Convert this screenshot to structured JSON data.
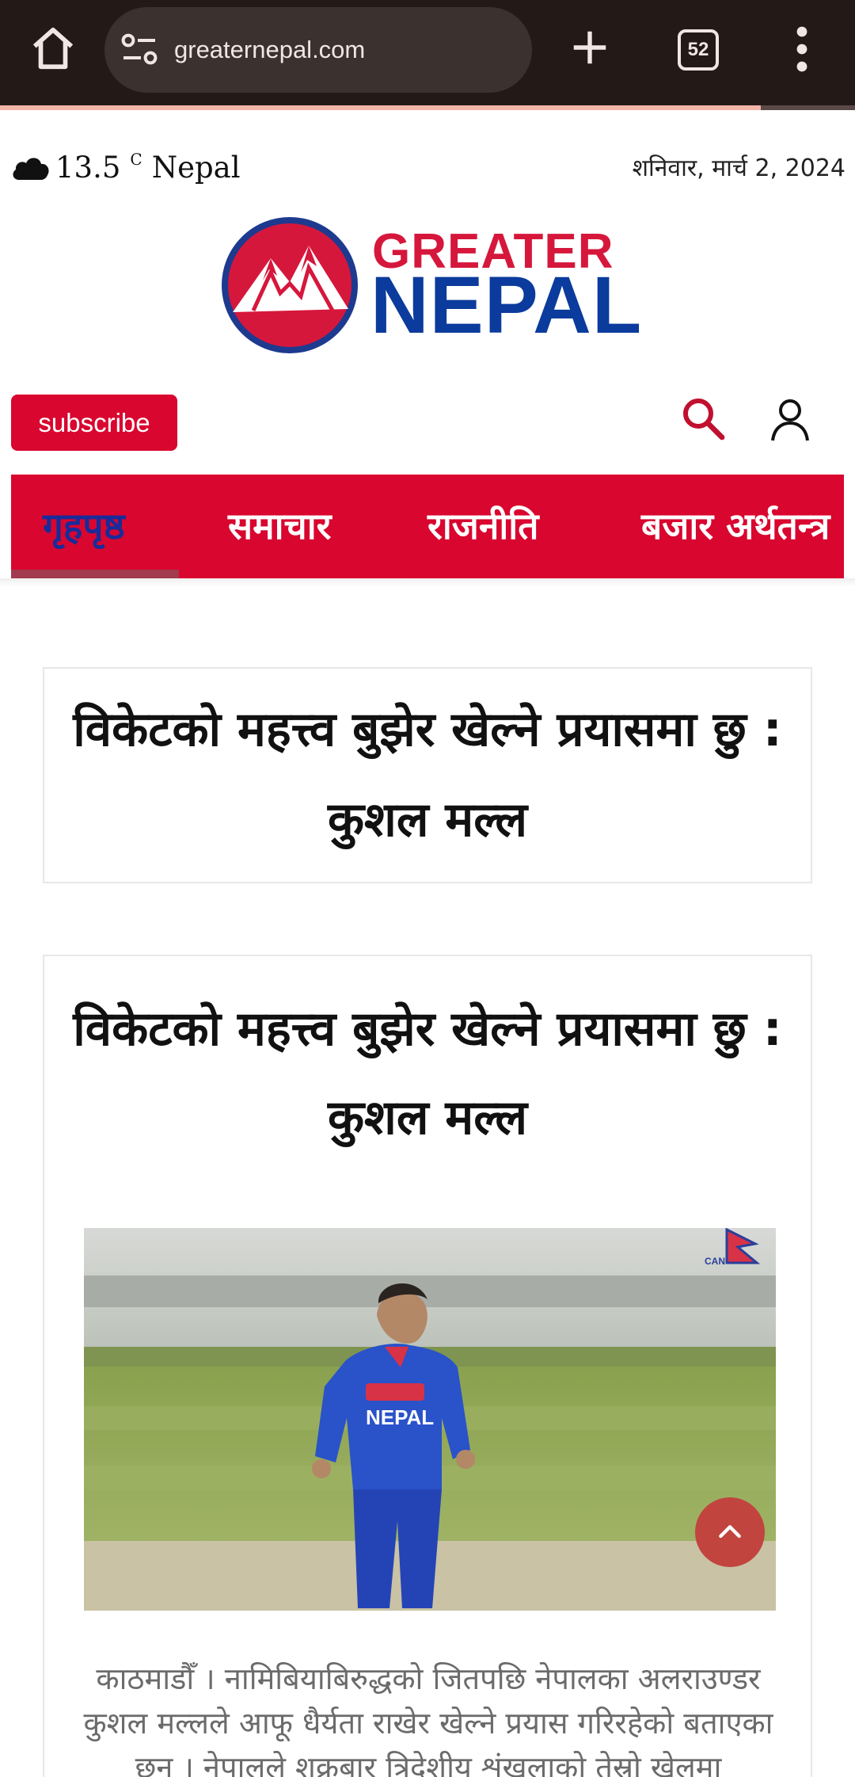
{
  "browser": {
    "url": "greaternepal.com",
    "tab_count": "52",
    "load_progress": 0.89
  },
  "topbar": {
    "temperature": "13.5",
    "unit": "C",
    "location": "Nepal",
    "date": "शनिवार, मार्च 2, 2024"
  },
  "logo": {
    "line1": "GREATER",
    "line2": "NEPAL"
  },
  "header": {
    "subscribe_label": "subscribe"
  },
  "nav": {
    "items": [
      {
        "label": "गृहपृष्ठ",
        "active": true
      },
      {
        "label": "समाचार"
      },
      {
        "label": "राजनीति"
      },
      {
        "label": "बजार अर्थतन्त्र"
      }
    ]
  },
  "article": {
    "page_title": "विकेटको महत्त्व बुझेर खेल्ने प्रयासमा छु : कुशल मल्ल",
    "headline": "विकेटको महत्त्व बुझेर खेल्ने प्रयासमा छु : कुशल मल्ल",
    "body": "काठमाडौँ । नामिबियाबिरुद्धको जितपछि नेपालका अलराउण्डर कुशल मल्लले आफू धैर्यता राखेर खेल्ने प्रयास गरिरहेको बताएका छन् । नेपालले शुक्रबार त्रिदेशीय शृंखलाको तेस्रो खेलमा",
    "photo_jersey_text": "NEPAL",
    "photo_badge_text": "CAN"
  },
  "colors": {
    "brand_red": "#d9062f",
    "brand_blue": "#0b3b9c",
    "nav_active": "#1a2b99"
  }
}
